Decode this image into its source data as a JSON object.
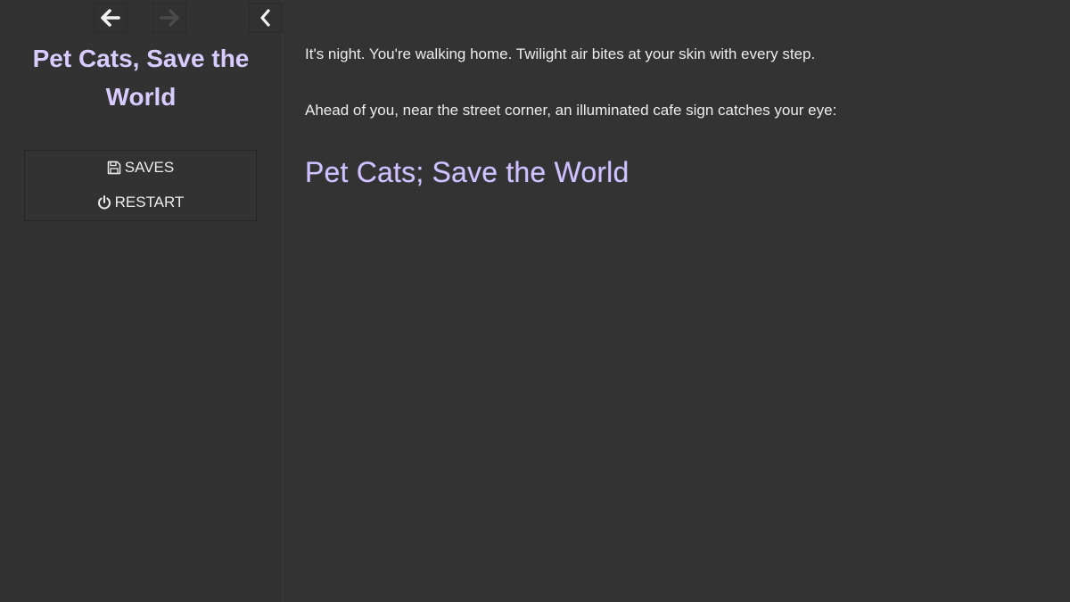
{
  "sidebar": {
    "nav": {
      "back_icon": "arrow-left-icon",
      "forward_icon": "arrow-right-icon",
      "toggle_icon": "chevron-left-icon"
    },
    "story_title": "Pet Cats, Save the World",
    "menu": {
      "saves_label": "SAVES",
      "saves_icon": "floppy-disk-icon",
      "restart_label": "RESTART",
      "restart_icon": "power-icon"
    }
  },
  "passage": {
    "paragraph_1": "It's night. You're walking home. Twilight air bites at your skin with every step.",
    "paragraph_2": "Ahead of you, near the street corner, an illuminated cafe sign catches your eye:",
    "cafe_sign": "Pet Cats; Save the World"
  },
  "colors": {
    "background": "#333333",
    "sidebar_background": "#323232",
    "title_color": "#d8ccff",
    "sign_color": "#cfc2ff",
    "text_color": "#ececec"
  }
}
